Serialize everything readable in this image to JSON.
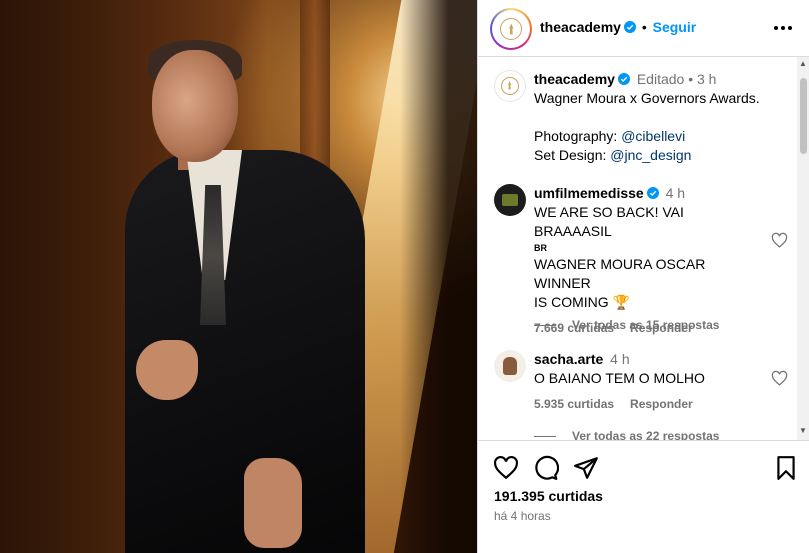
{
  "post": {
    "author": "theacademy",
    "follow_label": "Seguir",
    "more_icon": "more-horizontal-icon"
  },
  "caption": {
    "author": "theacademy",
    "edited": "Editado",
    "dot": "•",
    "time": "3 h",
    "line1": "Wagner Moura x Governors Awards.",
    "photo_label": "Photography:",
    "photo_handle": "@cibellevi",
    "set_label": "Set Design:",
    "set_handle": "@jnc_design"
  },
  "comments": [
    {
      "author": "umfilmemedisse",
      "time": "4 h",
      "line1": "WE ARE SO BACK! VAI BRAAAASIL",
      "flag": "BR",
      "line2": "WAGNER MOURA OSCAR WINNER",
      "line3": "IS COMING",
      "emoji": "🏆",
      "likes": "7.669 curtidas",
      "reply": "Responder",
      "view_replies": "Ver todas as 15 respostas"
    },
    {
      "author": "sacha.arte",
      "time": "4 h",
      "line1": "O BAIANO TEM O MOLHO",
      "likes": "5.935 curtidas",
      "reply": "Responder",
      "view_replies": "Ver todas as 22 respostas"
    }
  ],
  "footer": {
    "likes": "191.395 curtidas",
    "time_ago": "há 4 horas"
  },
  "colors": {
    "accent": "#0095f6",
    "verified": "#0095f6",
    "muted": "#737373",
    "border": "#dbdbdb"
  }
}
